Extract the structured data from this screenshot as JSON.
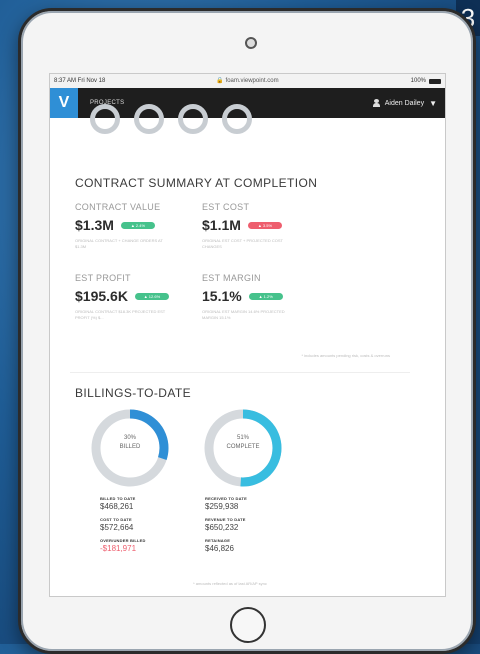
{
  "corner_label": "3",
  "statusbar": {
    "time": "8:37 AM  Fri Nov 18",
    "url": "🔒 foam.viewpoint.com",
    "signal": "100%"
  },
  "appbar": {
    "logo": "V",
    "nav_projects": "PROJECTS",
    "user_name": "Aiden Dailey",
    "caret": "▼"
  },
  "contract_summary": {
    "title": "CONTRACT SUMMARY AT COMPLETION",
    "metrics": [
      {
        "label": "CONTRACT VALUE",
        "value": "$1.3M",
        "pill_color": "#46c28c",
        "pill_text": "▲ 2.4%",
        "sub": "ORIGINAL CONTRACT + CHANGE ORDERS AT $1.3M"
      },
      {
        "label": "EST COST",
        "value": "$1.1M",
        "pill_color": "#ee5e6e",
        "pill_text": "▲ 3.5%",
        "sub": "ORIGINAL EST COST + PROJECTED COST CHANGES"
      },
      {
        "label": "EST PROFIT",
        "value": "$195.6K",
        "pill_color": "#46c28c",
        "pill_text": "▲ 12.6%",
        "sub": "ORIGINAL CONTRACT $18.3K PROJECTED EST PROFIT (%) $..."
      },
      {
        "label": "EST MARGIN",
        "value": "15.1%",
        "pill_color": "#46c28c",
        "pill_text": "▲ 1.2%",
        "sub": "ORIGINAL EST MARGIN 14.6% PROJECTED MARGIN 15.1%"
      }
    ],
    "footnote": "* includes amounts pending risk, costs & overruns"
  },
  "billings": {
    "title": "BILLINGS-TO-DATE",
    "rings": [
      {
        "pct_text": "30%",
        "sub": "BILLED",
        "fraction": 0.3,
        "color": "#2f8fd6"
      },
      {
        "pct_text": "51%",
        "sub": "COMPLETE",
        "fraction": 0.51,
        "color": "#38bde0"
      }
    ],
    "left_col": [
      {
        "label": "BILLED TO DATE",
        "value": "$468,261",
        "negative": false
      },
      {
        "label": "COST TO DATE",
        "value": "$572,664",
        "negative": false
      },
      {
        "label": "OVER/UNDER BILLED",
        "value": "-$181,971",
        "negative": true
      }
    ],
    "right_col": [
      {
        "label": "RECEIVED TO DATE",
        "value": "$259,938",
        "negative": false
      },
      {
        "label": "REVENUE TO DATE",
        "value": "$650,232",
        "negative": false
      },
      {
        "label": "RETAINAGE",
        "value": "$46,826",
        "negative": false
      }
    ],
    "bottom_note": "* amounts reflected as of last AR/AP sync"
  }
}
